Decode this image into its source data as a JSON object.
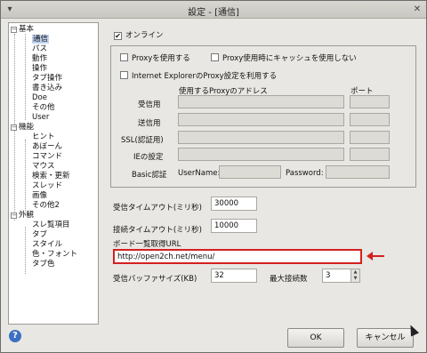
{
  "window": {
    "title": "設定 - [通信]"
  },
  "tree": {
    "groups": [
      {
        "label": "基本",
        "expander": "−",
        "children": [
          "通信",
          "パス",
          "動作",
          "操作",
          "タブ操作",
          "書き込み",
          "Doe",
          "その他",
          "User"
        ]
      },
      {
        "label": "機能",
        "expander": "−",
        "children": [
          "ヒント",
          "あぼーん",
          "コマンド",
          "マウス",
          "検索・更新",
          "スレッド",
          "画像",
          "その他2"
        ]
      },
      {
        "label": "外観",
        "expander": "−",
        "children": [
          "スレ覧項目",
          "タブ",
          "スタイル",
          "色・フォント",
          "タブ色"
        ]
      }
    ]
  },
  "online": {
    "label": "オンライン",
    "checked": "✔"
  },
  "proxy": {
    "use_proxy_label": "Proxyを使用する",
    "no_cache_label": "Proxy使用時にキャッシュを使用しない",
    "ie_label": "Internet ExplorerのProxy設定を利用する",
    "address_header": "使用するProxyのアドレス",
    "port_header": "ポート",
    "rows": [
      "受信用",
      "送信用",
      "SSL(認証用)",
      "IEの設定"
    ],
    "basic_auth_label": "Basic認証",
    "username_label": "UserName:",
    "password_label": "Password:"
  },
  "timeouts": {
    "recv_label": "受信タイムアウト(ミリ秒)",
    "recv_value": "30000",
    "conn_label": "接続タイムアウト(ミリ秒)",
    "conn_value": "10000"
  },
  "board_list": {
    "label": "ボード一覧取得URL",
    "value": "http://open2ch.net/menu/"
  },
  "buffer": {
    "label": "受信バッファサイズ(KB)",
    "value": "32"
  },
  "max_conn": {
    "label": "最大接続数",
    "value": "3"
  },
  "buttons": {
    "ok": "OK",
    "cancel": "キャンセル",
    "help": "?"
  },
  "colors": {
    "highlight_border": "#d42020",
    "selected_bg": "#bfd2ee",
    "window_bg": "#e8e7e3"
  }
}
